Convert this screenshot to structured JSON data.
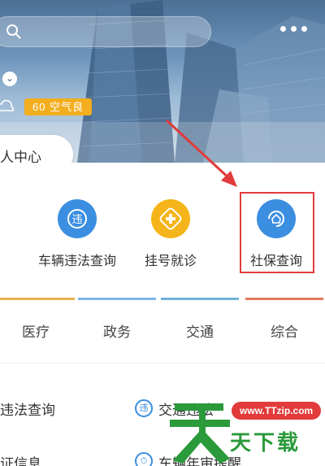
{
  "header": {
    "air_quality": "60 空气良",
    "personal_center": "人中心"
  },
  "services": [
    {
      "label": "车辆违法查询",
      "icon": "violation-icon",
      "glyph": "违",
      "color": "#3b8ee0"
    },
    {
      "label": "挂号就诊",
      "icon": "medical-cross-icon",
      "glyph": "✚",
      "color": "#f5b41a"
    },
    {
      "label": "社保查询",
      "icon": "social-security-icon",
      "glyph": "⌂",
      "color": "#3b8ee0"
    }
  ],
  "tabs": [
    {
      "label": "医疗",
      "color": "#e8b04a"
    },
    {
      "label": "政务",
      "color": "#7cb6e6"
    },
    {
      "label": "交通",
      "color": "#6fb3d9"
    },
    {
      "label": "综合",
      "color": "#e07a5f"
    }
  ],
  "list": {
    "item_1": "违法查询",
    "item_2": "交通违法",
    "item_3": "证信息",
    "item_4": "车辆年审提醒",
    "icon_2_glyph": "违",
    "icon_4_glyph": "⏱"
  },
  "watermark": {
    "url": "www.TTzip.com",
    "text": "天下载"
  },
  "colors": {
    "highlight": "#e23b3b",
    "accent": "#3b8ee0"
  }
}
